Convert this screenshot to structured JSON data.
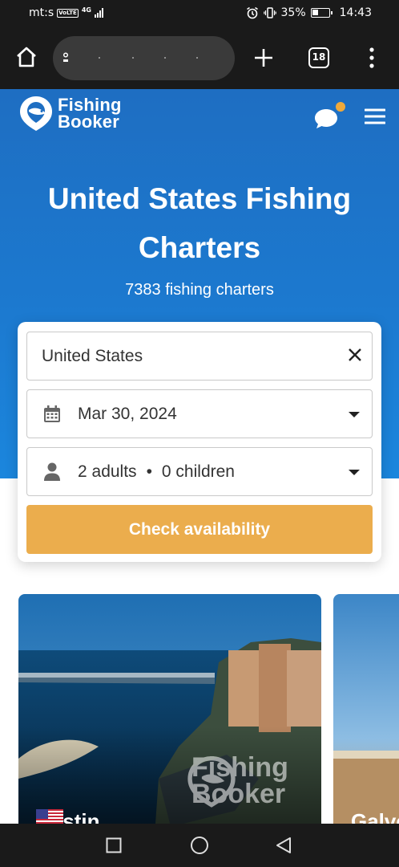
{
  "status_bar": {
    "carrier": "mt:s",
    "volte": "VoLTE",
    "network": "4G",
    "battery": "35%",
    "time": "14:43"
  },
  "browser": {
    "tab_count": "18"
  },
  "header": {
    "logo_line1": "Fishing",
    "logo_line2": "Booker",
    "notification_color": "#f0a93b"
  },
  "hero": {
    "title": "United States Fishing Charters",
    "subtitle": "7383 fishing charters"
  },
  "search": {
    "location": "United States",
    "date": "Mar 30, 2024",
    "adults": "2 adults",
    "separator": "•",
    "children": "0 children",
    "button_label": "Check availability",
    "button_color": "#ebad4d"
  },
  "destinations": [
    {
      "name": "Destin"
    },
    {
      "name": "Galve"
    }
  ],
  "watermark": {
    "line1": "Fishing",
    "line2": "Booker"
  }
}
